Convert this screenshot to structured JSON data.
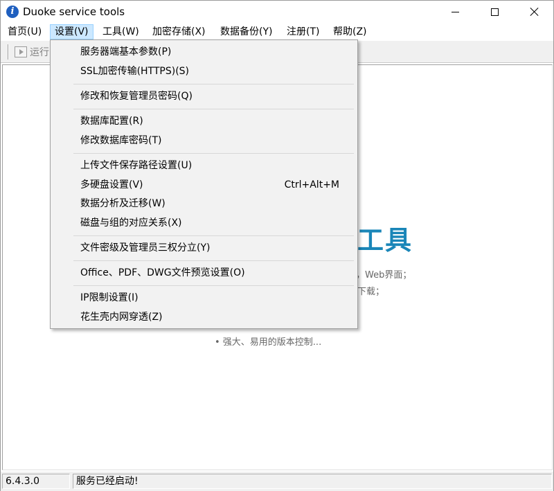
{
  "window": {
    "title": "Duoke service tools",
    "icon": "info-i-icon"
  },
  "menubar": {
    "items": [
      {
        "label": "首页(U)"
      },
      {
        "label": "设置(V)"
      },
      {
        "label": "工具(W)"
      },
      {
        "label": "加密存储(X)"
      },
      {
        "label": "数据备份(Y)"
      },
      {
        "label": "注册(T)"
      },
      {
        "label": "帮助(Z)"
      }
    ],
    "active_index": 1
  },
  "toolbar": {
    "run_label": "运行"
  },
  "content": {
    "hero_title": "工具",
    "features": [
      "，Web界面；",
      "下载；",
      "• 强大、易用的版本控制..."
    ]
  },
  "statusbar": {
    "version": "6.4.3.0",
    "message": "服务已经启动!"
  },
  "dropdown": {
    "items": [
      {
        "label": "服务器端基本参数(P)"
      },
      {
        "label": "SSL加密传输(HTTPS)(S)"
      },
      {
        "label": "修改和恢复管理员密码(Q)"
      },
      {
        "label": "数据库配置(R)"
      },
      {
        "label": "修改数据库密码(T)"
      },
      {
        "label": "上传文件保存路径设置(U)"
      },
      {
        "label": "多硬盘设置(V)",
        "shortcut": "Ctrl+Alt+M"
      },
      {
        "label": "数据分析及迁移(W)"
      },
      {
        "label": "磁盘与组的对应关系(X)"
      },
      {
        "label": "文件密级及管理员三权分立(Y)"
      },
      {
        "label": "Office、PDF、DWG文件预览设置(O)"
      },
      {
        "label": "IP限制设置(I)"
      },
      {
        "label": "花生壳内网穿透(Z)"
      }
    ]
  },
  "colors": {
    "menu_highlight": "#cce8ff",
    "hero_accent": "#1a86b8",
    "dropdown_bg": "#f2f2f2"
  }
}
